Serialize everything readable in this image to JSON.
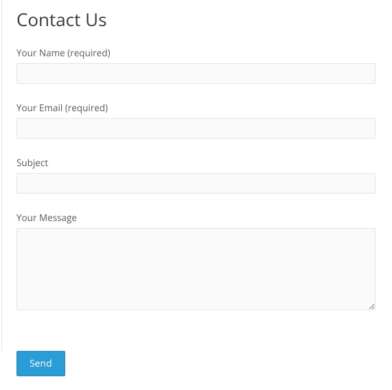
{
  "page": {
    "title": "Contact Us"
  },
  "form": {
    "name": {
      "label": "Your Name (required)",
      "value": ""
    },
    "email": {
      "label": "Your Email (required)",
      "value": ""
    },
    "subject": {
      "label": "Subject",
      "value": ""
    },
    "message": {
      "label": "Your Message",
      "value": ""
    },
    "submit_label": "Send"
  }
}
